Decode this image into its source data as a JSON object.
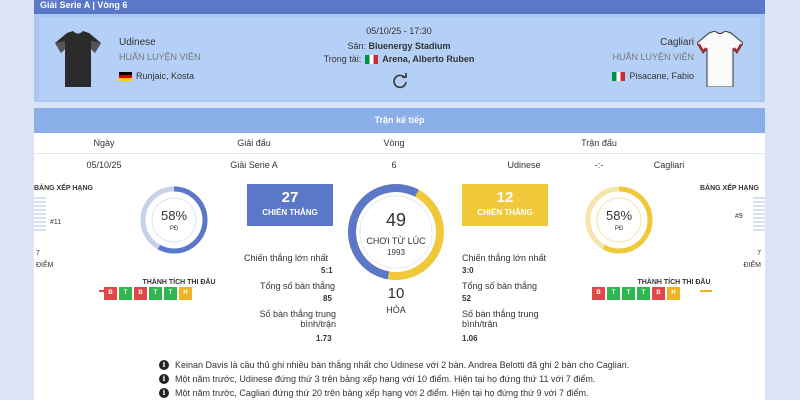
{
  "header": {
    "title": "Giải Serie A | Vòng 6"
  },
  "match": {
    "home": {
      "name": "Udinese",
      "role": "HUẤN LUYỆN VIÊN",
      "coach": "Runjaic, Kosta"
    },
    "away": {
      "name": "Cagliari",
      "role": "HUẤN LUYỆN VIÊN",
      "coach": "Pisacane, Fabio"
    },
    "datetime": "05/10/25 - 17:30",
    "stadium_label": "Sân:",
    "stadium": "Bluenergy Stadium",
    "referee_label": "Trọng tài:",
    "referee": "Arena, Alberto Ruben"
  },
  "next_match": {
    "title": "Trận kế tiếp",
    "columns": [
      "Ngày",
      "Giải đấu",
      "Vòng",
      "Trận đấu"
    ],
    "row": {
      "date": "05/10/25",
      "league": "Giải Serie A",
      "round": "6",
      "home": "Udinese",
      "score": "-:-",
      "away": "Cagliari"
    }
  },
  "stats": {
    "home": {
      "ranking_label": "BẢNG XẾP HẠNG",
      "rank": "#11",
      "points": "7",
      "points_label": "ĐIỂM",
      "pct": "58%",
      "pct_label": "PĐ",
      "pct_value": 0.58,
      "history_label": "THÀNH TÍCH THI ĐẤU",
      "history": [
        "B",
        "T",
        "B",
        "T",
        "T",
        "H"
      ],
      "wins": "27",
      "wins_label": "CHIẾN THẮNG",
      "big_win_label": "Chiến thắng lớn nhất",
      "big_win": "5:1",
      "goals_label": "Tổng số bàn thắng",
      "goals": "85",
      "avg_label": "Số bàn thắng trung bình/trận",
      "avg": "1.73",
      "color": "#5b78c8"
    },
    "away": {
      "ranking_label": "BẢNG XẾP HẠNG",
      "rank": "#9",
      "points": "7",
      "points_label": "ĐIỂM",
      "pct": "58%",
      "pct_label": "PĐ",
      "pct_value": 0.58,
      "history_label": "THÀNH TÍCH THI ĐẤU",
      "history": [
        "B",
        "T",
        "T",
        "T",
        "B",
        "H"
      ],
      "wins": "12",
      "wins_label": "CHIẾN THẮNG",
      "big_win_label": "Chiến thắng lớn nhất",
      "big_win": "3:0",
      "goals_label": "Tổng số bàn thắng",
      "goals": "52",
      "avg_label": "Số bàn thắng trung bình/trận",
      "avg": "1.06",
      "color": "#f0c93a"
    },
    "center": {
      "matches": "49",
      "since_label": "CHƠI TỪ LÚC",
      "since": "1993",
      "draws": "10",
      "draws_label": "HÒA",
      "home_share": 0.55
    }
  },
  "notes": [
    "Keinan Davis là cầu thủ ghi nhiều bàn thắng nhất cho Udinese với 2 bàn. Andrea Belotti đã ghi 2 bàn cho Cagliari.",
    "Một năm trước, Udinese đứng thứ 3 trên bảng xếp hạng với 10 điểm. Hiện tại họ đứng thứ 11 với 7 điểm.",
    "Một năm trước, Cagliari đứng thứ 20 trên bảng xếp hạng với 2 điểm. Hiện tại họ đứng thứ 9 với 7 điểm."
  ]
}
